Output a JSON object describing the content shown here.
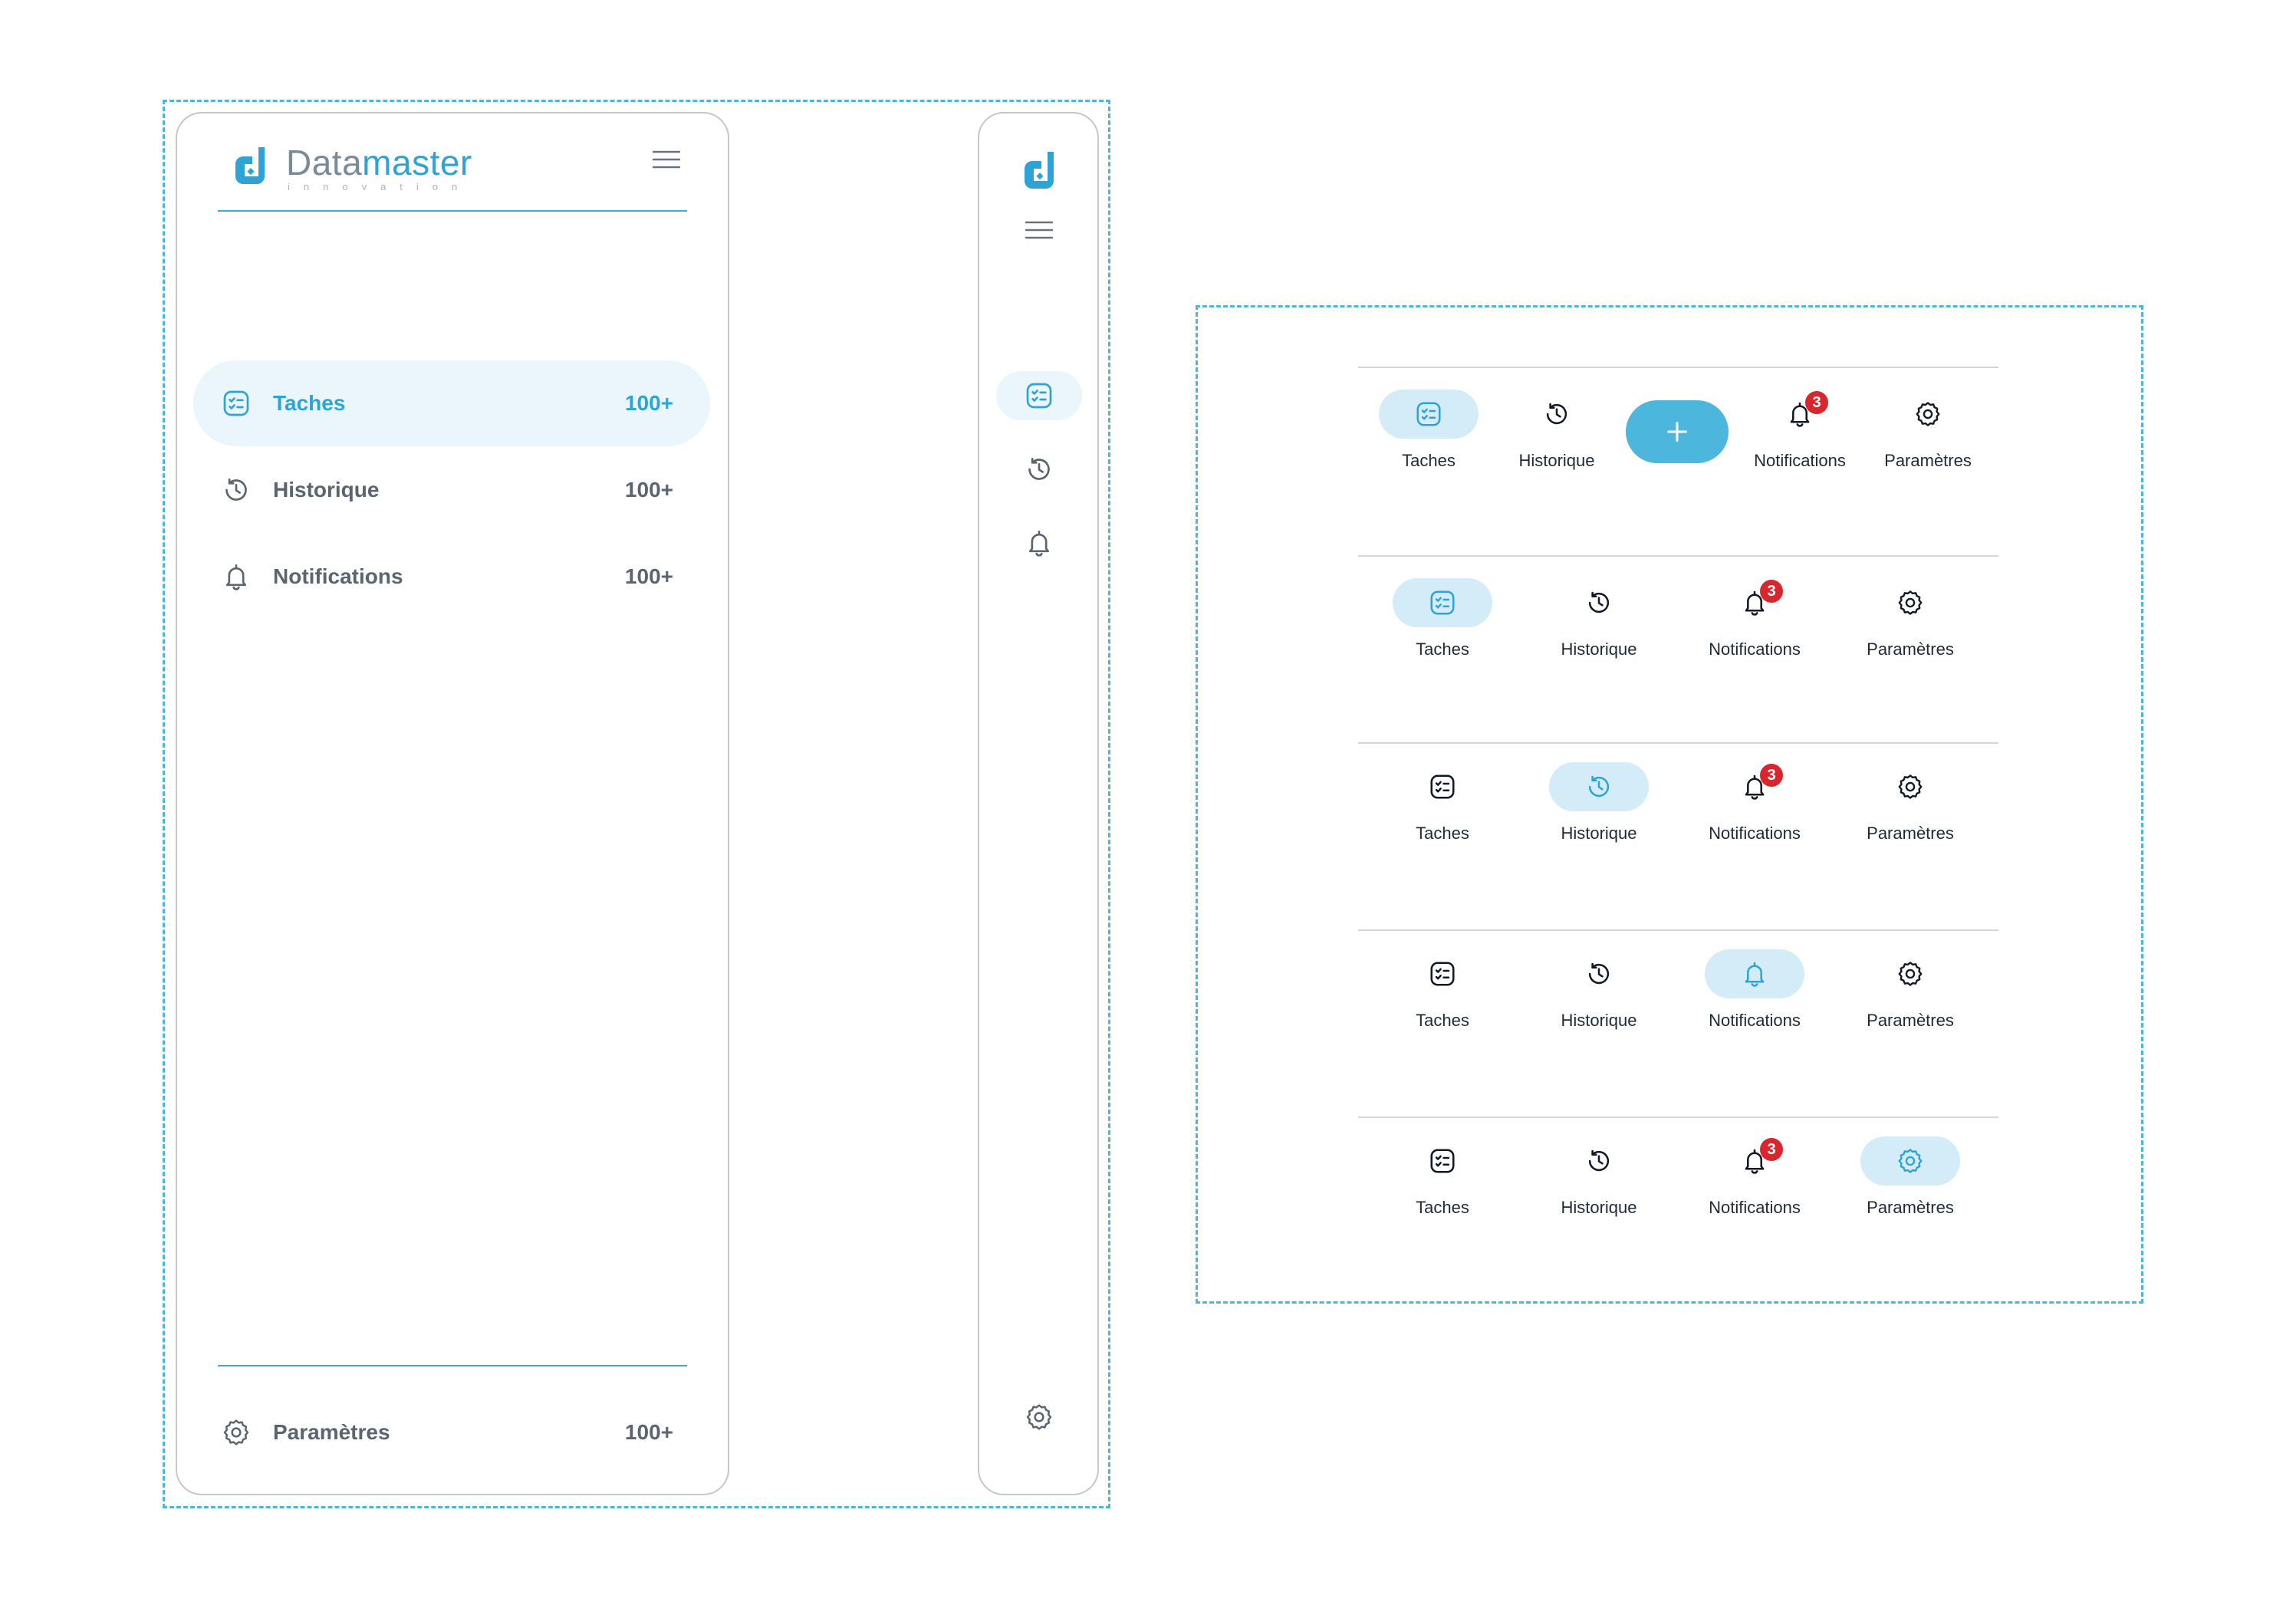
{
  "brand": {
    "name_part1": "Data",
    "name_part2": "master",
    "tagline": "innovation",
    "accent": "#2ea3d6"
  },
  "sidebar": {
    "items": [
      {
        "label": "Taches",
        "count": "100+",
        "icon": "task-list-icon",
        "active": true
      },
      {
        "label": "Historique",
        "count": "100+",
        "icon": "history-icon",
        "active": false
      },
      {
        "label": "Notifications",
        "count": "100+",
        "icon": "bell-icon",
        "active": false
      }
    ],
    "footer": {
      "label": "Paramètres",
      "count": "100+",
      "icon": "gear-icon"
    }
  },
  "bottom_nav": {
    "labels": {
      "tasks": "Taches",
      "history": "Historique",
      "notifications": "Notifications",
      "settings": "Paramètres"
    },
    "badge_count": "3",
    "fab_icon": "plus-icon",
    "variants": [
      {
        "active": "tasks",
        "with_fab": true
      },
      {
        "active": "tasks",
        "with_fab": false
      },
      {
        "active": "history",
        "with_fab": false
      },
      {
        "active": "notifications",
        "with_fab": false
      },
      {
        "active": "settings",
        "with_fab": false
      }
    ]
  },
  "colors": {
    "active_bg": "#eaf6fc",
    "pill_bg": "#d4ecf8",
    "fab": "#4cb6dd",
    "badge": "#d9262c",
    "muted": "#5c6470"
  }
}
